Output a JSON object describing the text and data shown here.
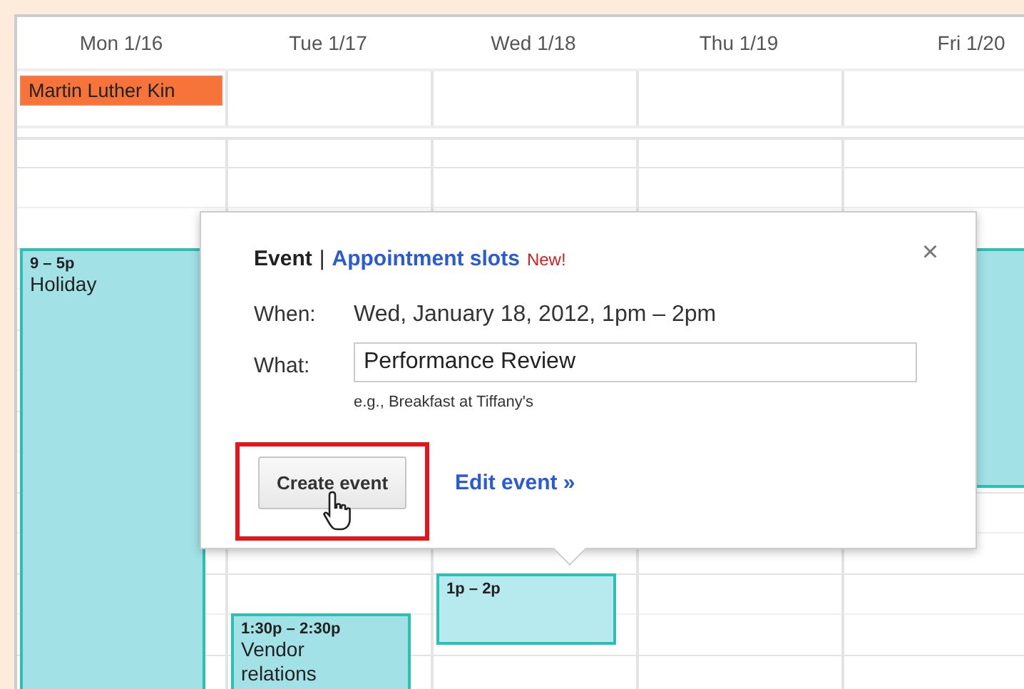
{
  "days": [
    {
      "label": "Mon 1/16",
      "all_day": [
        {
          "title": "Martin Luther Kin",
          "color": "#f6733a"
        }
      ],
      "events": [
        {
          "time": "9 – 5p",
          "title": "Holiday",
          "color": "#a2e1e6"
        }
      ]
    },
    {
      "label": "Tue 1/17",
      "events": [
        {
          "time": "1:30p – 2:30p",
          "title": "Vendor relations",
          "color": "#a2e1e6"
        }
      ]
    },
    {
      "label": "Wed 1/18",
      "events": [
        {
          "time": "1p – 2p",
          "color": "#b6eaee"
        }
      ]
    },
    {
      "label": "Thu 1/19"
    },
    {
      "label": "Fri 1/20",
      "events": [
        {
          "color": "#a2e1e6"
        }
      ]
    }
  ],
  "popup": {
    "tabs": [
      {
        "label": "Event",
        "selected": true
      },
      {
        "label": "Appointment slots",
        "selected": false
      }
    ],
    "separator": "|",
    "badge": "New!",
    "close": "×",
    "when_label": "When:",
    "when_value": "Wed, January 18, 2012, 1pm – 2pm",
    "what_label": "What:",
    "what_value": "Performance Review",
    "hint": "e.g., Breakfast at Tiffany's",
    "create_button": {
      "label": "Create event",
      "highlighted": true
    },
    "edit_link": "Edit event »"
  }
}
